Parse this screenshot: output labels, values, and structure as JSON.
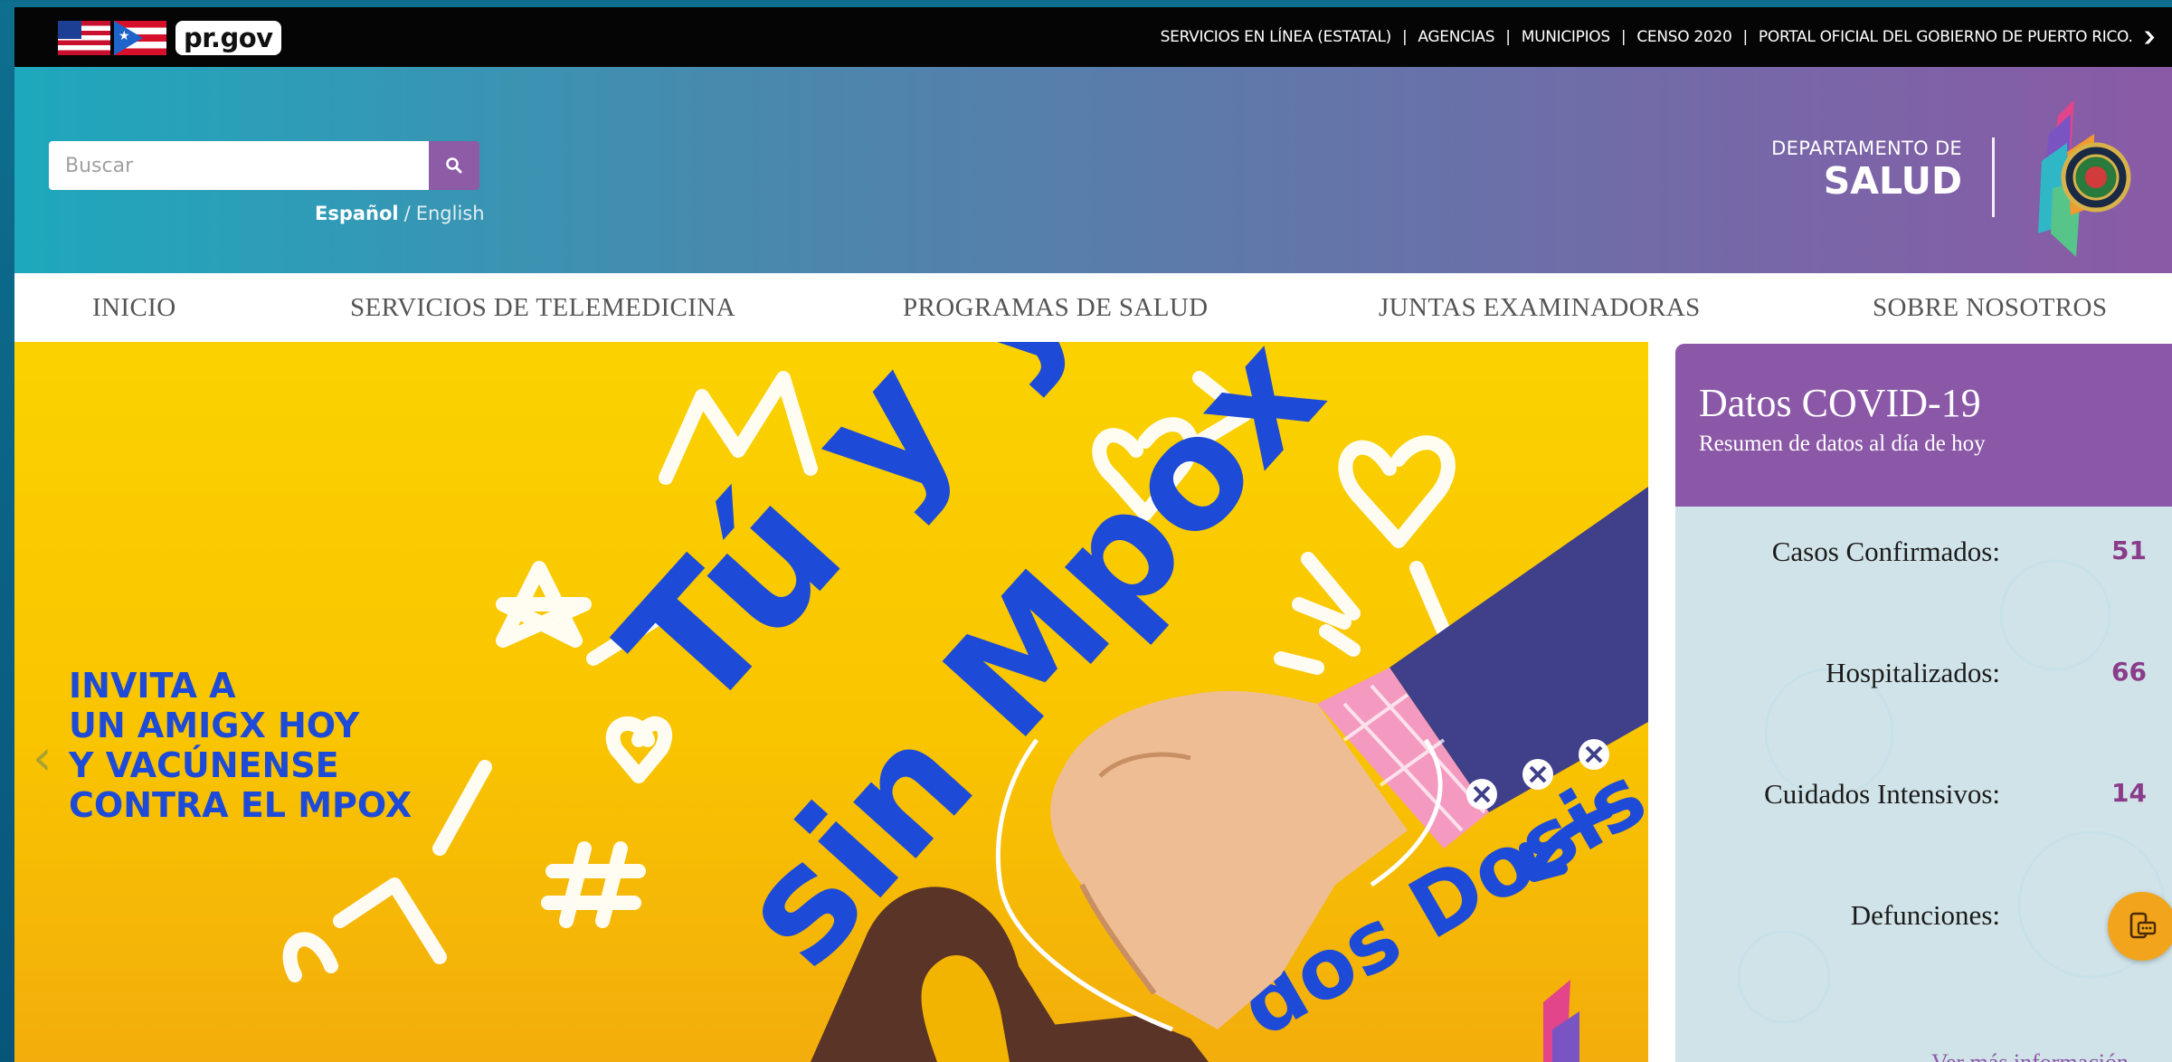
{
  "topbar": {
    "brand": "pr.gov",
    "links": [
      "SERVICIOS EN LÍNEA (ESTATAL)",
      "AGENCIAS",
      "MUNICIPIOS",
      "CENSO 2020",
      "PORTAL OFICIAL DEL GOBIERNO DE PUERTO RICO."
    ],
    "separator": "|"
  },
  "header": {
    "search_placeholder": "Buscar",
    "lang_es": "Español",
    "lang_sep": "/",
    "lang_en": "English",
    "dept_line1": "DEPARTAMENTO DE",
    "dept_line2": "SALUD"
  },
  "nav": {
    "items": [
      "INICIO",
      "SERVICIOS DE TELEMEDICINA",
      "PROGRAMAS DE SALUD",
      "JUNTAS EXAMINADORAS",
      "SOBRE NOSOTROS"
    ]
  },
  "hero": {
    "headline_script_1": "Tú y yo",
    "headline_script_2": "sin Mpox",
    "tagline_script": "dos Dosis",
    "message_lines": [
      "INVITA A",
      "UN AMIGX HOY",
      "Y VACÚNENSE",
      "CONTRA EL MPOX"
    ],
    "prev_arrow": "‹"
  },
  "covid": {
    "title": "Datos COVID-19",
    "subtitle": "Resumen de datos al día de hoy",
    "rows": [
      {
        "label": "Casos Confirmados:",
        "value": "51"
      },
      {
        "label": "Hospitalizados:",
        "value": "66"
      },
      {
        "label": "Cuidados Intensivos:",
        "value": "14"
      },
      {
        "label": "Defunciones:",
        "value": ""
      }
    ],
    "more_link": "Ver más información"
  },
  "colors": {
    "accent_purple": "#8b58a8",
    "hero_yellow": "#fbd200",
    "hero_blue": "#1d4bd8",
    "chat_orange": "#f2a51c"
  }
}
